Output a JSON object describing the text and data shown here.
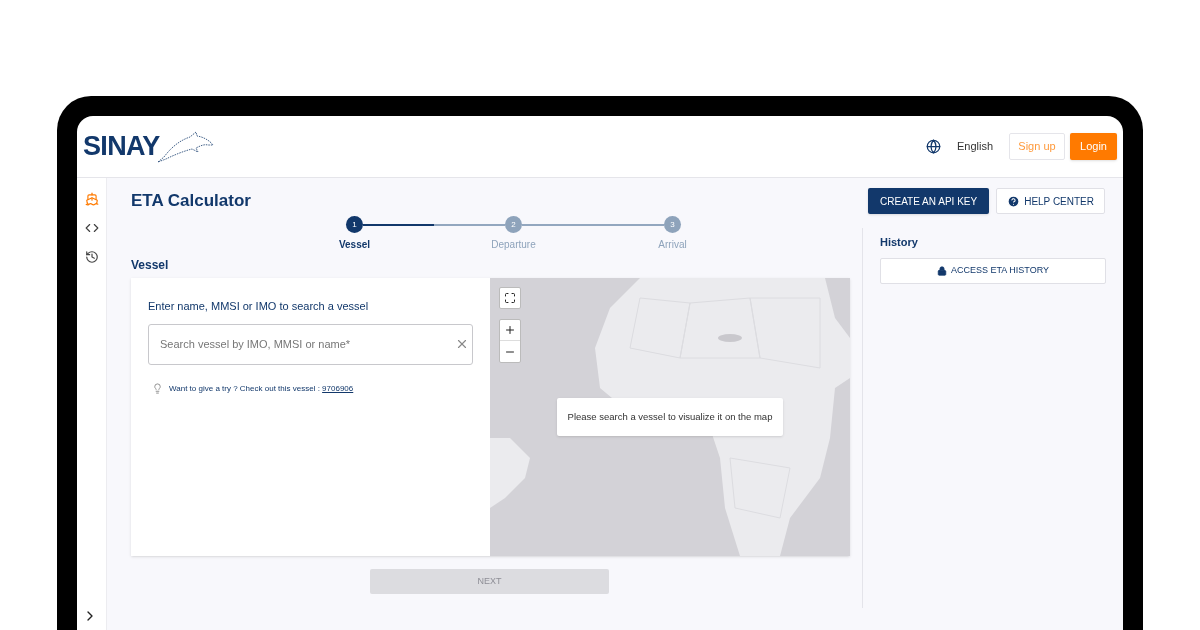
{
  "header": {
    "logo": "SINAY",
    "language": "English",
    "buttons": [
      {
        "label": "Sign up",
        "kind": "outline"
      },
      {
        "label": "Login",
        "kind": "primary"
      }
    ]
  },
  "sidebar": {
    "items": [
      {
        "kind": "ship",
        "selected": true
      },
      {
        "kind": "code",
        "selected": false
      },
      {
        "kind": "history",
        "selected": false
      }
    ]
  },
  "page": {
    "title": "ETA Calculator",
    "actions": [
      {
        "label": "CREATE AN API KEY",
        "kind": "primary"
      },
      {
        "label": "HELP CENTER",
        "kind": "help"
      }
    ]
  },
  "stepper": [
    {
      "number": "1",
      "label": "Vessel",
      "selected": true
    },
    {
      "number": "2",
      "label": "Departure",
      "selected": false
    },
    {
      "number": "3",
      "label": "Arrival",
      "selected": false
    }
  ],
  "section_title": "Vessel",
  "search": {
    "label": "Enter name, MMSI or IMO to search a vessel",
    "placeholder": "Search vessel by IMO, MMSI or name*",
    "hint": "Want to give a try ? Check out this vessel : ",
    "hint_link": "9706906"
  },
  "map": {
    "kind": "picture",
    "message": "Please search a vessel to visualize it on the map"
  },
  "next_button": {
    "label": "NEXT",
    "disabled": true
  },
  "history": {
    "title": "History",
    "button": "ACCESS ETA HISTORY"
  }
}
